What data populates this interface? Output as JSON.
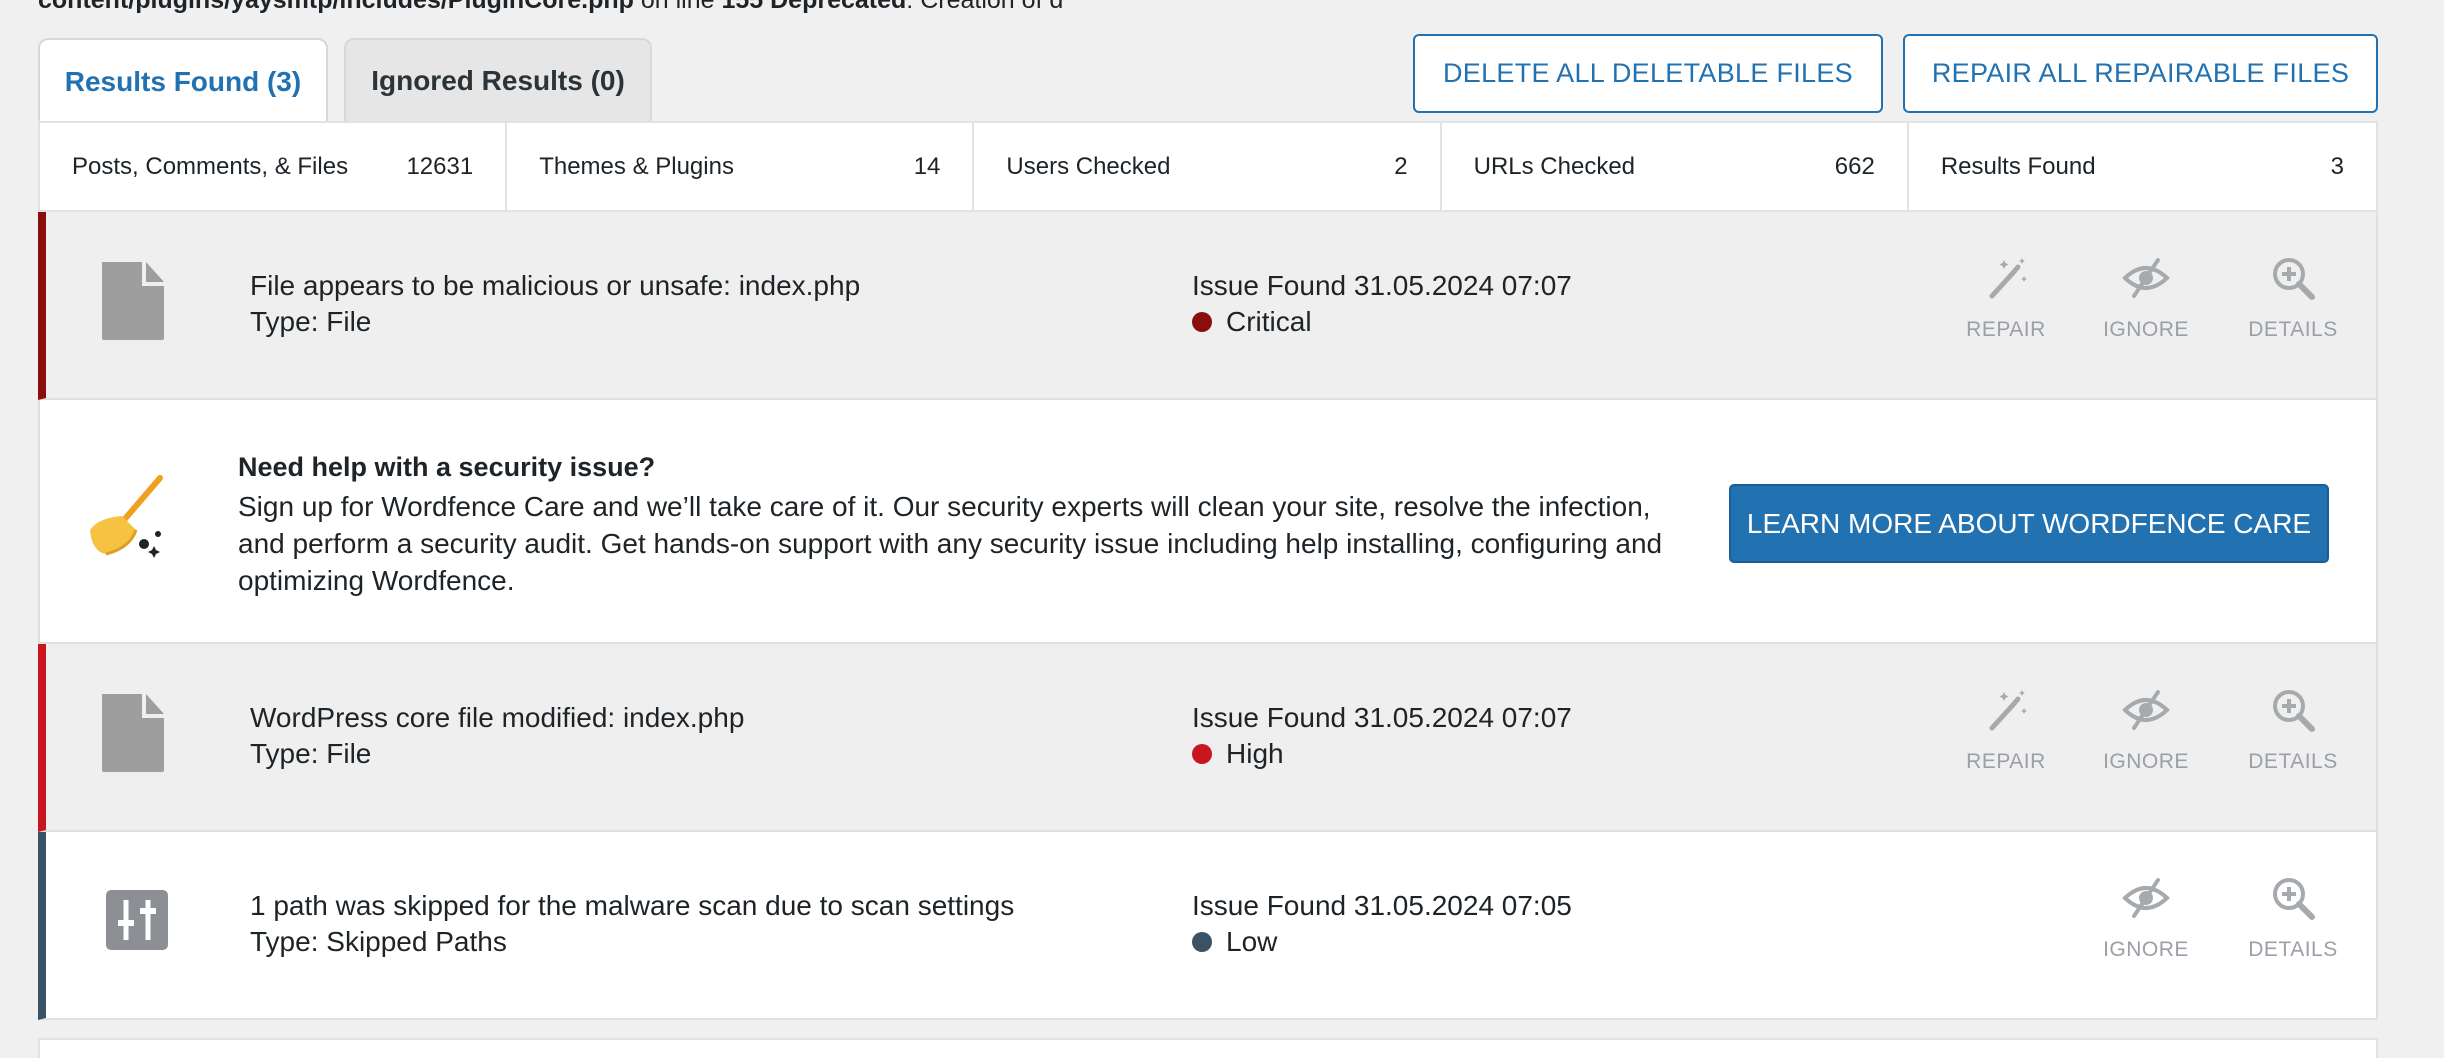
{
  "notice": {
    "path": "content/plugins/yaysmtp/includes/PluginCore.php",
    "on_line": " on line ",
    "line": "155",
    "deprecated": " Deprecated",
    "rest": ": Creation of d"
  },
  "tabs": [
    {
      "label": "Results Found (3)",
      "active": true
    },
    {
      "label": "Ignored Results (0)",
      "active": false
    }
  ],
  "buttons": {
    "delete_all": "DELETE ALL DELETABLE FILES",
    "repair_all": "REPAIR ALL REPAIRABLE FILES"
  },
  "stats": [
    {
      "label": "Posts, Comments, & Files",
      "value": "12631"
    },
    {
      "label": "Themes & Plugins",
      "value": "14"
    },
    {
      "label": "Users Checked",
      "value": "2"
    },
    {
      "label": "URLs Checked",
      "value": "662"
    },
    {
      "label": "Results Found",
      "value": "3"
    }
  ],
  "issues": [
    {
      "title": "File appears to be malicious or unsafe: index.php",
      "type": "Type: File",
      "found": "Issue Found 31.05.2024 07:07",
      "severity": "Critical",
      "severity_color": "#8b0e0e",
      "icon": "file-icon",
      "actions": {
        "repair": "REPAIR",
        "ignore": "IGNORE",
        "details": "DETAILS"
      }
    },
    {
      "title": "WordPress core file modified: index.php",
      "type": "Type: File",
      "found": "Issue Found 31.05.2024 07:07",
      "severity": "High",
      "severity_color": "#c9151e",
      "icon": "file-icon",
      "actions": {
        "repair": "REPAIR",
        "ignore": "IGNORE",
        "details": "DETAILS"
      }
    },
    {
      "title": "1 path was skipped for the malware scan due to scan settings",
      "type": "Type: Skipped Paths",
      "found": "Issue Found 31.05.2024 07:05",
      "severity": "Low",
      "severity_color": "#3b5266",
      "icon": "sliders-icon",
      "actions": {
        "ignore": "IGNORE",
        "details": "DETAILS"
      }
    }
  ],
  "promo": {
    "heading": "Need help with a security issue?",
    "text": "Sign up for Wordfence Care and we’ll take care of it. Our security experts will clean your site, resolve the infection, and perform a security audit. Get hands-on support with any security issue including help installing, configuring and optimizing Wordfence.",
    "button": "LEARN MORE ABOUT WORDFENCE CARE",
    "icon": "broom-icon"
  },
  "colors": {
    "accent": "#2271b1"
  }
}
